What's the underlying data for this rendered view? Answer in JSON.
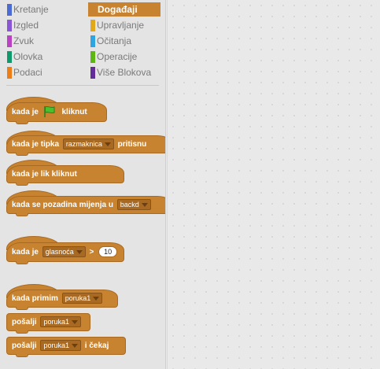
{
  "categories": [
    {
      "label": "Kretanje",
      "color": "#4a6cd4"
    },
    {
      "label": "Događaji",
      "color": "#c88330",
      "selected": true
    },
    {
      "label": "Izgled",
      "color": "#8a55d7"
    },
    {
      "label": "Upravljanje",
      "color": "#e1a91a"
    },
    {
      "label": "Zvuk",
      "color": "#bb42c3"
    },
    {
      "label": "Očitanja",
      "color": "#2ca5e2"
    },
    {
      "label": "Olovka",
      "color": "#0e9a6c"
    },
    {
      "label": "Operacije",
      "color": "#5cb712"
    },
    {
      "label": "Podaci",
      "color": "#ee7d16"
    },
    {
      "label": "Više Blokova",
      "color": "#632d99"
    }
  ],
  "blocks": {
    "flag": {
      "pre": "kada je",
      "post": "kliknut"
    },
    "key": {
      "pre": "kada je tipka",
      "dropdown": "razmaknica",
      "post": "pritisnu"
    },
    "sprite": {
      "text": "kada je lik kliknut"
    },
    "backdrop": {
      "pre": "kada se pozadina mijenja u",
      "dropdown": "backd"
    },
    "sensor": {
      "pre": "kada je",
      "dropdown": "glasnoća",
      "op": ">",
      "value": "10"
    },
    "receive": {
      "pre": "kada primim",
      "dropdown": "poruka1"
    },
    "broadcast": {
      "pre": "pošalji",
      "dropdown": "poruka1"
    },
    "broadcastwait": {
      "pre": "pošalji",
      "dropdown": "poruka1",
      "post": "i čekaj"
    }
  }
}
